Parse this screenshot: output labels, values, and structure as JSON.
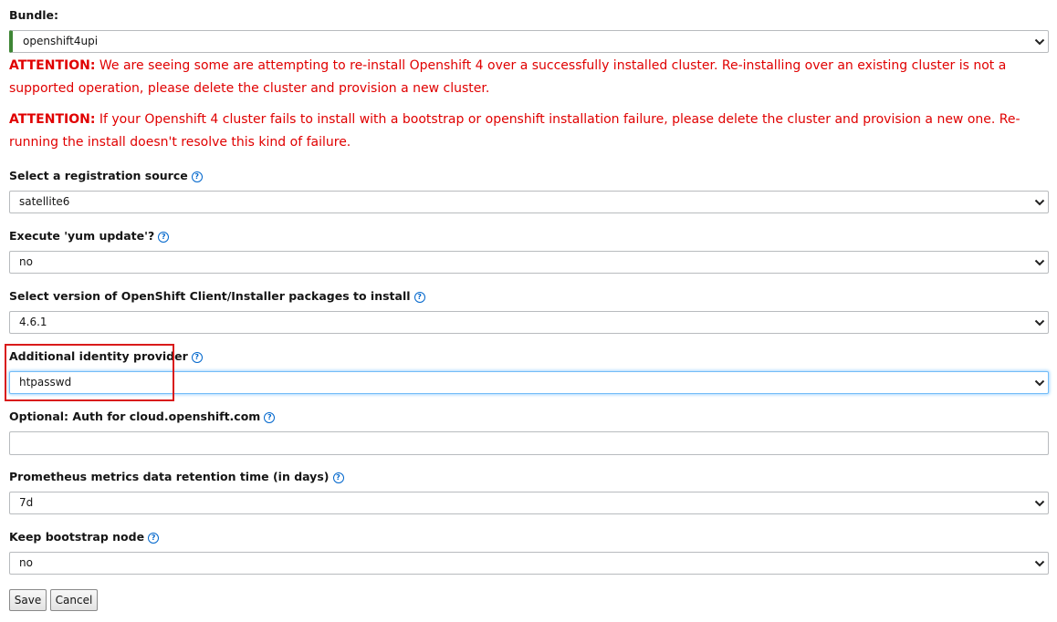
{
  "bundle": {
    "label": "Bundle:",
    "value": "openshift4upi",
    "accent_color": "#3e8635"
  },
  "warnings": [
    {
      "prefix": "ATTENTION:",
      "text": " We are seeing some are attempting to re-install Openshift 4 over a successfully installed cluster. Re-installing over an existing cluster is not a supported operation, please delete the cluster and provision a new cluster."
    },
    {
      "prefix": "ATTENTION:",
      "text": " If your Openshift 4 cluster fails to install with a bootstrap or openshift installation failure, please delete the cluster and provision a new one. Re-running the install doesn't resolve this kind of failure."
    }
  ],
  "warning_color": "#e00000",
  "fields": {
    "registration_source": {
      "label": "Select a registration source",
      "value": "satellite6",
      "help_icon": "question-circle-icon"
    },
    "yum_update": {
      "label": "Execute 'yum update'?",
      "value": "no",
      "help_icon": "question-circle-icon"
    },
    "client_version": {
      "label": "Select version of OpenShift Client/Installer packages to install",
      "value": "4.6.1",
      "help_icon": "question-circle-icon"
    },
    "identity_provider": {
      "label": "Additional identity provider",
      "value": "htpasswd",
      "help_icon": "question-circle-icon"
    },
    "cloud_auth": {
      "label": "Optional: Auth for cloud.openshift.com",
      "value": "",
      "help_icon": "question-circle-icon"
    },
    "prometheus_retention": {
      "label": "Prometheus metrics data retention time (in days)",
      "value": "7d",
      "help_icon": "question-circle-icon"
    },
    "keep_bootstrap": {
      "label": "Keep bootstrap node",
      "value": "no",
      "help_icon": "question-circle-icon"
    }
  },
  "help_glyph": "?",
  "buttons": {
    "save": "Save",
    "cancel": "Cancel"
  },
  "highlight_color": "#d91a1a"
}
